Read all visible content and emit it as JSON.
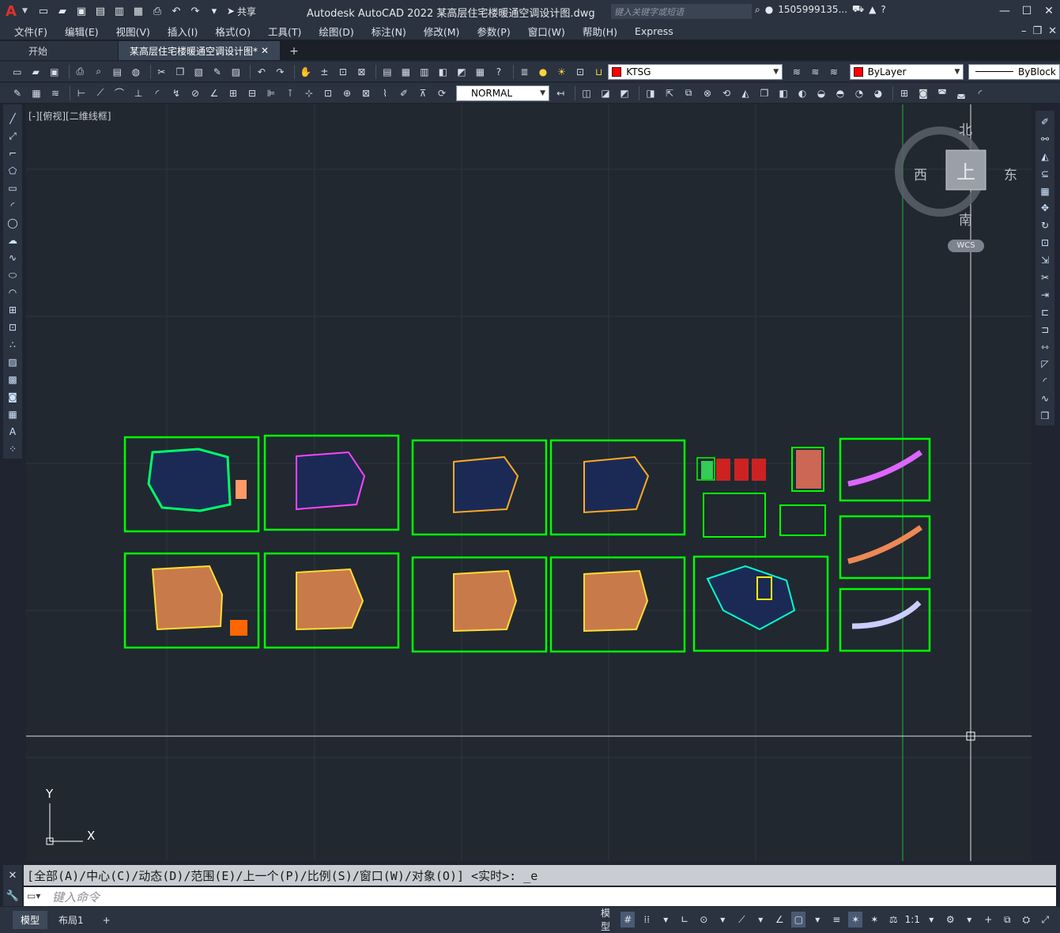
{
  "titlebar": {
    "logo": "A",
    "share": "共享",
    "app_title": "Autodesk AutoCAD 2022    某高层住宅楼暖通空调设计图.dwg",
    "search_placeholder": "键入关键字或短语",
    "user": "1505999135...",
    "help": "?"
  },
  "menu": {
    "items": [
      "文件(F)",
      "编辑(E)",
      "视图(V)",
      "插入(I)",
      "格式(O)",
      "工具(T)",
      "绘图(D)",
      "标注(N)",
      "修改(M)",
      "参数(P)",
      "窗口(W)",
      "帮助(H)",
      "Express"
    ]
  },
  "tabs": {
    "start": "开始",
    "drawing": "某高层住宅楼暖通空调设计图*",
    "close": "✕",
    "add": "+"
  },
  "toolbar": {
    "layer_name": "KTSG",
    "color": "ByLayer",
    "linetype": "ByBlock",
    "text_style": "NORMAL",
    "layer_color": "#ff0000"
  },
  "viewport": {
    "label": "[-][俯视][二维线框]",
    "compass_n": "北",
    "compass_s": "南",
    "compass_e": "东",
    "compass_w": "西",
    "compass_top": "上",
    "wcs": "WCS",
    "ucs_x": "X",
    "ucs_y": "Y"
  },
  "command": {
    "history": "[全部(A)/中心(C)/动态(D)/范围(E)/上一个(P)/比例(S)/窗口(W)/对象(O)] <实时>: _e",
    "placeholder": "键入命令"
  },
  "status": {
    "model_tab": "模型",
    "layout_tab": "布局1",
    "add_tab": "+",
    "model_btn": "模型",
    "scale": "1:1"
  },
  "colors": {
    "frame": "#00ff00",
    "background": "#212830",
    "accent_red": "#e0312a"
  }
}
